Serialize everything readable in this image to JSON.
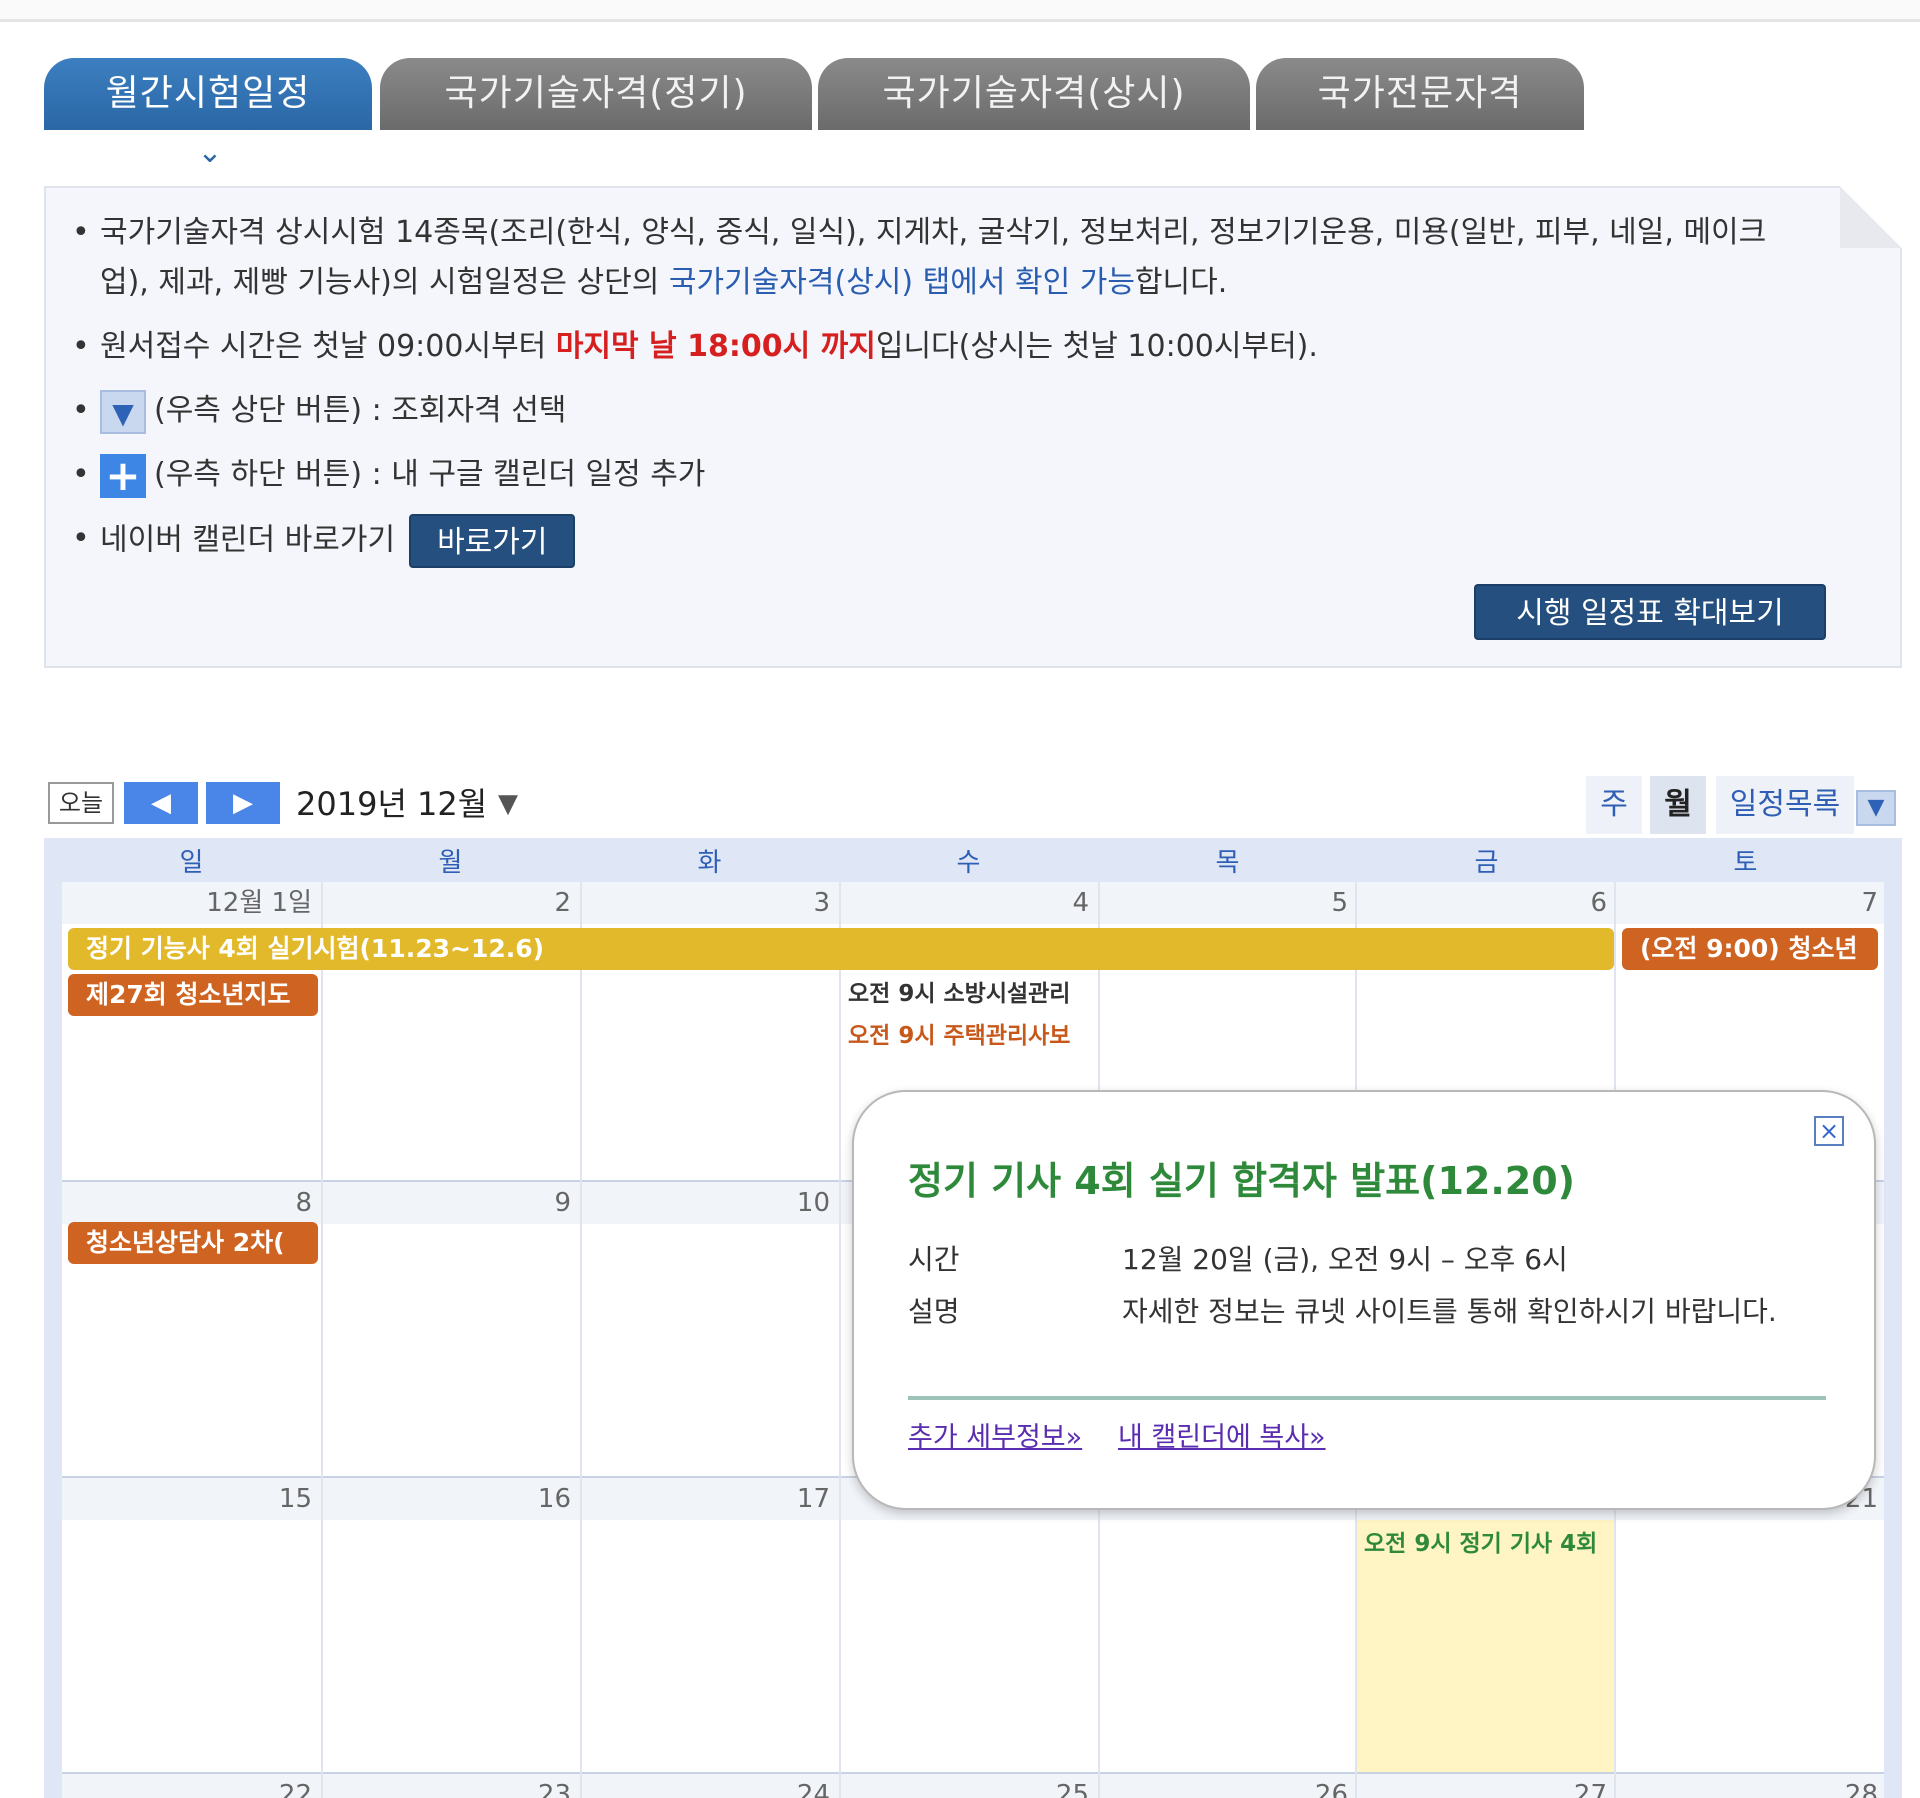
{
  "tabs": [
    {
      "label": "월간시험일정",
      "active": true
    },
    {
      "label": "국가기술자격(정기)",
      "active": false
    },
    {
      "label": "국가기술자격(상시)",
      "active": false
    },
    {
      "label": "국가전문자격",
      "active": false
    }
  ],
  "notice": {
    "item1_part1": "국가기술자격 상시시험 14종목(조리(한식, 양식, 중식, 일식), 지게차, 굴삭기, 정보처리, 정보기기운용, 미용(일반, 피부, 네일, 메이크업), 제과, 제빵 기능사)의 시험일정은 상단의 ",
    "item1_link": "국가기술자격(상시) 탭에서 확인 가능",
    "item1_part2": "합니다.",
    "item2_part1": "원서접수 시간은 첫날 09:00시부터 ",
    "item2_red": "마지막 날 18:00시 까지",
    "item2_part2": "입니다(상시는 첫날 10:00시부터).",
    "item3_text": "(우측 상단 버튼) : 조회자격 선택",
    "item4_text": "(우측 하단 버튼) : 내 구글 캘린더 일정 추가",
    "item5_text": "네이버 캘린더 바로가기",
    "goto_label": "바로가기",
    "expand_label": "시행 일정표 확대보기"
  },
  "toolbar": {
    "today_label": "오늘",
    "prev_icon": "◀",
    "next_icon": "▶",
    "month_title": "2019년 12월",
    "views": [
      "주",
      "월",
      "일정목록"
    ],
    "active_view": "월"
  },
  "weekdays": [
    "일",
    "월",
    "화",
    "수",
    "목",
    "금",
    "토"
  ],
  "weeks": [
    [
      "12월 1일",
      "2",
      "3",
      "4",
      "5",
      "6",
      "7"
    ],
    [
      "8",
      "9",
      "10",
      "",
      "",
      "",
      ""
    ],
    [
      "15",
      "16",
      "17",
      "",
      "",
      "",
      "21"
    ],
    [
      "22",
      "23",
      "24",
      "25",
      "26",
      "27",
      "28"
    ]
  ],
  "events": {
    "e1": "정기 기능사 4회 실기시험(11.23~12.6)",
    "e2": "(오전 9:00) 청소년",
    "e3": "제27회 청소년지도",
    "e4": "오전 9시 소방시설관리",
    "e5": "오전 9시 주택관리사보",
    "e6": "청소년상담사 2차(",
    "e7": "오전 9시 정기 기사 4회"
  },
  "popup": {
    "title": "정기 기사 4회 실기 합격자 발표(12.20)",
    "time_label": "시간",
    "time_value": "12월 20일 (금), 오전 9시 – 오후 6시",
    "desc_label": "설명",
    "desc_value": "자세한 정보는 큐넷 사이트를 통해 확인하시기 바랍니다.",
    "link1": "추가 세부정보»",
    "link2": "내 캘린더에 복사»"
  },
  "colors": {
    "tab_active": "#2a67a6",
    "event_yellow": "#e2b92b",
    "event_orange": "#cf6422",
    "popup_title": "#2e8a3a"
  }
}
